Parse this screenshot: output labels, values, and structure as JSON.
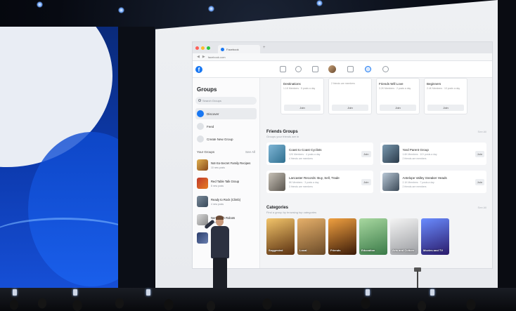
{
  "browser": {
    "tab_title": "Facebook",
    "url": "facebook.com"
  },
  "facebook": {
    "logo": "f",
    "sidebar": {
      "title": "Groups",
      "search_placeholder": "Search Groups",
      "items": [
        {
          "label": "Discover",
          "active": true
        },
        {
          "label": "Feed"
        },
        {
          "label": "Create New Group"
        }
      ],
      "your_groups_label": "Your Groups",
      "see_all": "See All",
      "groups": [
        {
          "name": "Not-So-Secret Family Recipes",
          "sub": "10 new posts"
        },
        {
          "name": "Red Table Talk Group",
          "sub": "8 new posts"
        },
        {
          "name": "Ready to Rock (Climb)",
          "sub": "4 new posts"
        },
        {
          "name": "Nerds with Robots",
          "sub": "5 new posts"
        },
        {
          "name": "Stargazers",
          "sub": "2 new posts"
        }
      ]
    },
    "top_cards": [
      {
        "title": "Destinations",
        "meta": "1.1K Members · 5 posts a day",
        "join": "Join"
      },
      {
        "title": "",
        "meta": "2 friends are members",
        "join": "Join"
      },
      {
        "title": "Friends Will Love",
        "meta": "3.2K Members · 2 posts a day",
        "join": "Join"
      },
      {
        "title": "Beginners",
        "meta": "2.4K Members · 10 posts a day",
        "join": "Join"
      }
    ],
    "friends_groups": {
      "title": "Friends Groups",
      "subtitle": "Groups your friends are in",
      "see_all": "See All",
      "items": [
        {
          "name": "Coast to Coast Cyclists",
          "meta": "12K Members · 4 posts a day",
          "friends": "4 friends are members",
          "join": "Join"
        },
        {
          "name": "Yard Parent Group",
          "meta": "1.6K Members · 10+ posts a day",
          "friends": "2 friends are members",
          "join": "Join"
        },
        {
          "name": "Lancaster Records: Buy, Sell, Trade",
          "meta": "8K Members · 3 posts a day",
          "friends": "3 friends are members",
          "join": "Join"
        },
        {
          "name": "Antelope Valley Sneaker Heads",
          "meta": "2.1K Members · 7 posts a day",
          "friends": "2 friends are members",
          "join": "Join"
        }
      ]
    },
    "categories": {
      "title": "Categories",
      "subtitle": "Find a group by browsing top categories",
      "see_all": "See All",
      "items": [
        {
          "label": "Suggested",
          "color": "#8a5a2b"
        },
        {
          "label": "Local",
          "color": "#a36d3a"
        },
        {
          "label": "Friends",
          "color": "#c06a1f"
        },
        {
          "label": "Education",
          "color": "#5aa06a"
        },
        {
          "label": "Arts and Culture",
          "color": "#b9bcc2"
        },
        {
          "label": "Movies and TV",
          "color": "#3a44b8"
        }
      ]
    }
  },
  "colors": {
    "facebook_blue": "#1877f2",
    "stage_blue": "#164fd6"
  }
}
